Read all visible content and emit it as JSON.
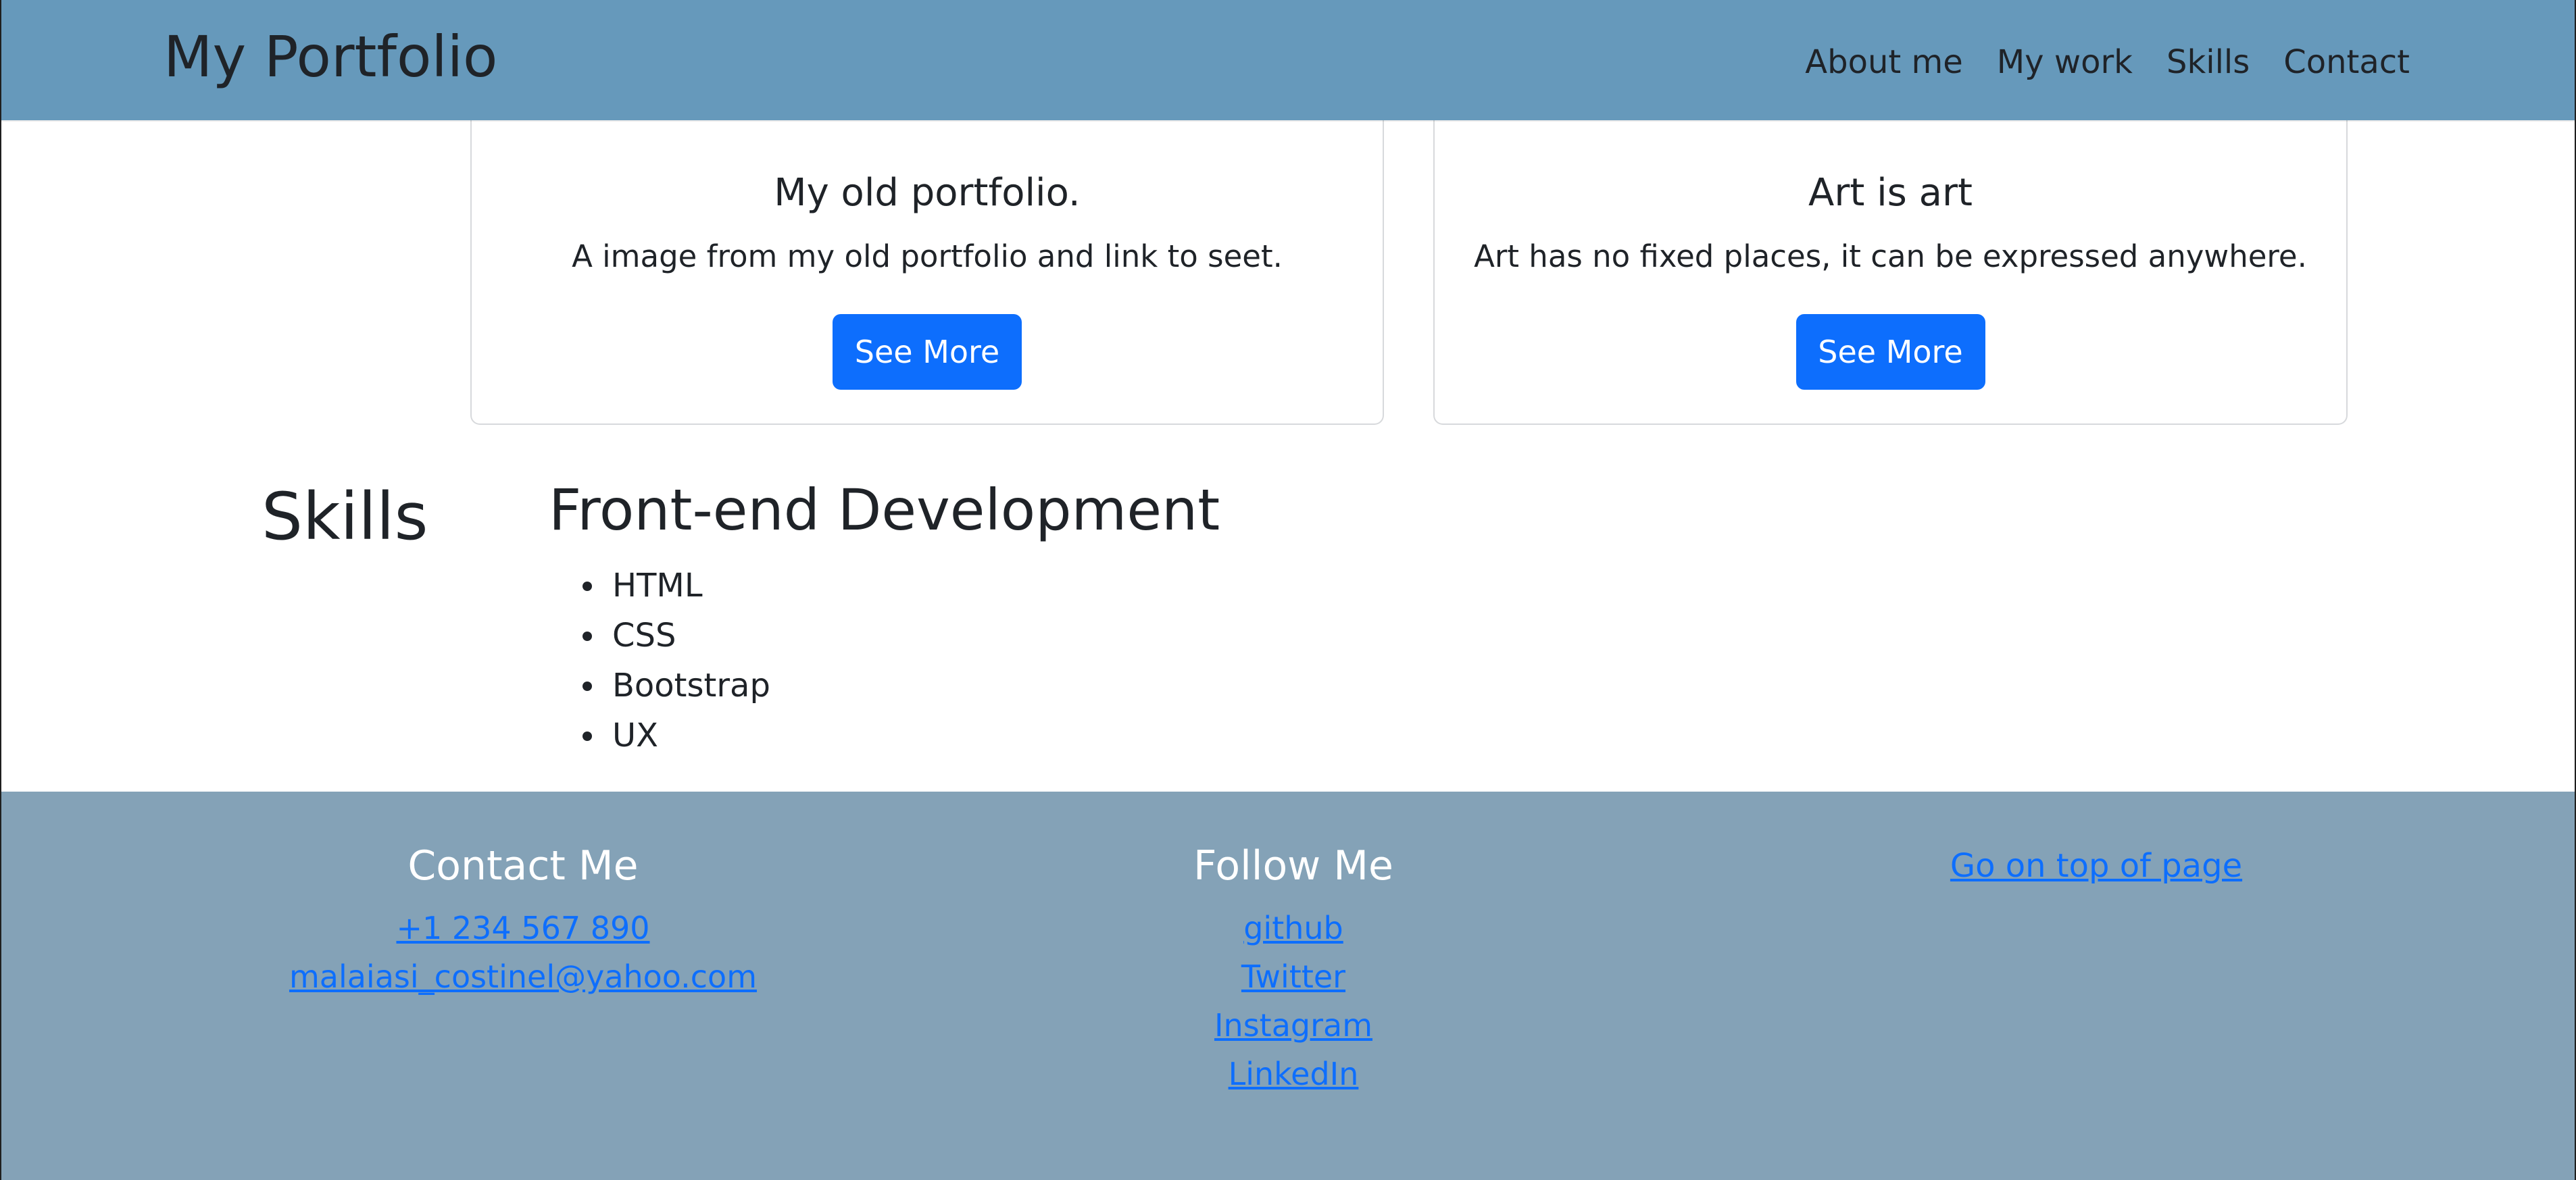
{
  "navbar": {
    "brand": "My Portfolio",
    "links": [
      "About me",
      "My work",
      "Skills",
      "Contact"
    ]
  },
  "cards": [
    {
      "title": "My old portfolio.",
      "text": "A image from my old portfolio and link to seet.",
      "button_label": "See More"
    },
    {
      "title": "Art is art",
      "text": "Art has no fixed places, it can be expressed anywhere.",
      "button_label": "See More"
    }
  ],
  "skills": {
    "heading": "Skills",
    "subheading": "Front-end Development",
    "items": [
      "HTML",
      "CSS",
      "Bootstrap",
      "UX"
    ]
  },
  "footer": {
    "contact": {
      "title": "Contact Me",
      "phone": "+1 234 567 890",
      "email": "malaiasi_costinel@yahoo.com"
    },
    "follow": {
      "title": "Follow Me",
      "links": [
        "github",
        "Twitter",
        "Instagram",
        "LinkedIn"
      ]
    },
    "top_link": "Go on top of page"
  },
  "colors": {
    "navbar": "#6699bb",
    "footer": "#84a2b7",
    "primary": "#0d6efd",
    "text": "#1f2328"
  }
}
